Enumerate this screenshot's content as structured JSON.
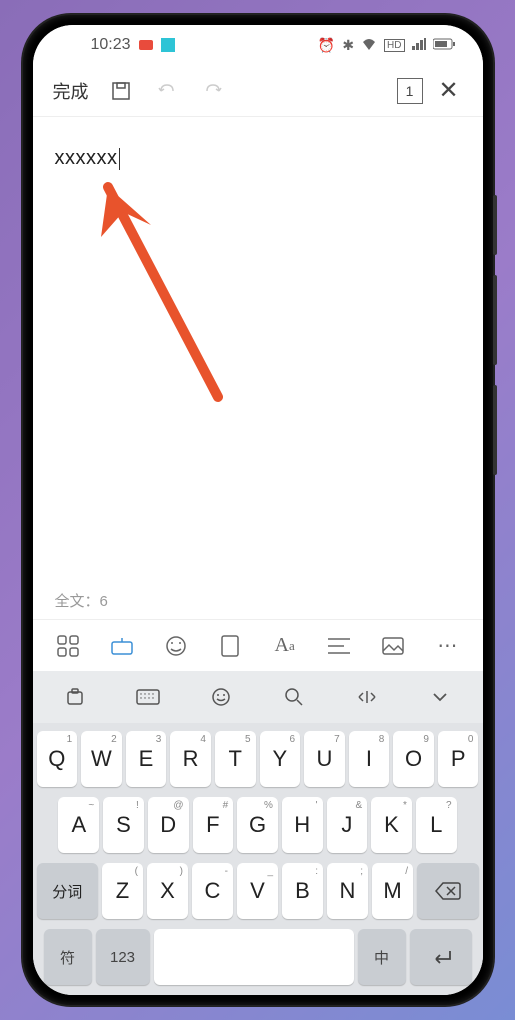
{
  "status": {
    "time": "10:23",
    "icons": [
      "alarm",
      "bluetooth",
      "wifi",
      "hd",
      "signal",
      "battery"
    ]
  },
  "toolbar": {
    "done_label": "完成",
    "page_count": "1"
  },
  "editor": {
    "content": "xxxxxx",
    "word_count_label": "全文：6"
  },
  "keyboard": {
    "row1": [
      {
        "main": "Q",
        "sup": "1"
      },
      {
        "main": "W",
        "sup": "2"
      },
      {
        "main": "E",
        "sup": "3"
      },
      {
        "main": "R",
        "sup": "4"
      },
      {
        "main": "T",
        "sup": "5"
      },
      {
        "main": "Y",
        "sup": "6"
      },
      {
        "main": "U",
        "sup": "7"
      },
      {
        "main": "I",
        "sup": "8"
      },
      {
        "main": "O",
        "sup": "9"
      },
      {
        "main": "P",
        "sup": "0"
      }
    ],
    "row2": [
      {
        "main": "A",
        "sup": "~"
      },
      {
        "main": "S",
        "sup": "!"
      },
      {
        "main": "D",
        "sup": "@"
      },
      {
        "main": "F",
        "sup": "#"
      },
      {
        "main": "G",
        "sup": "%"
      },
      {
        "main": "H",
        "sup": "'"
      },
      {
        "main": "J",
        "sup": "&"
      },
      {
        "main": "K",
        "sup": "*"
      },
      {
        "main": "L",
        "sup": "?"
      }
    ],
    "row3_shift": "分词",
    "row3": [
      {
        "main": "Z",
        "sup": "("
      },
      {
        "main": "X",
        "sup": ")"
      },
      {
        "main": "C",
        "sup": "-"
      },
      {
        "main": "V",
        "sup": "_"
      },
      {
        "main": "B",
        "sup": ":"
      },
      {
        "main": "N",
        "sup": ";"
      },
      {
        "main": "M",
        "sup": "/"
      }
    ],
    "row4": {
      "sym": "符",
      "num": "123",
      "lang": "中"
    }
  }
}
